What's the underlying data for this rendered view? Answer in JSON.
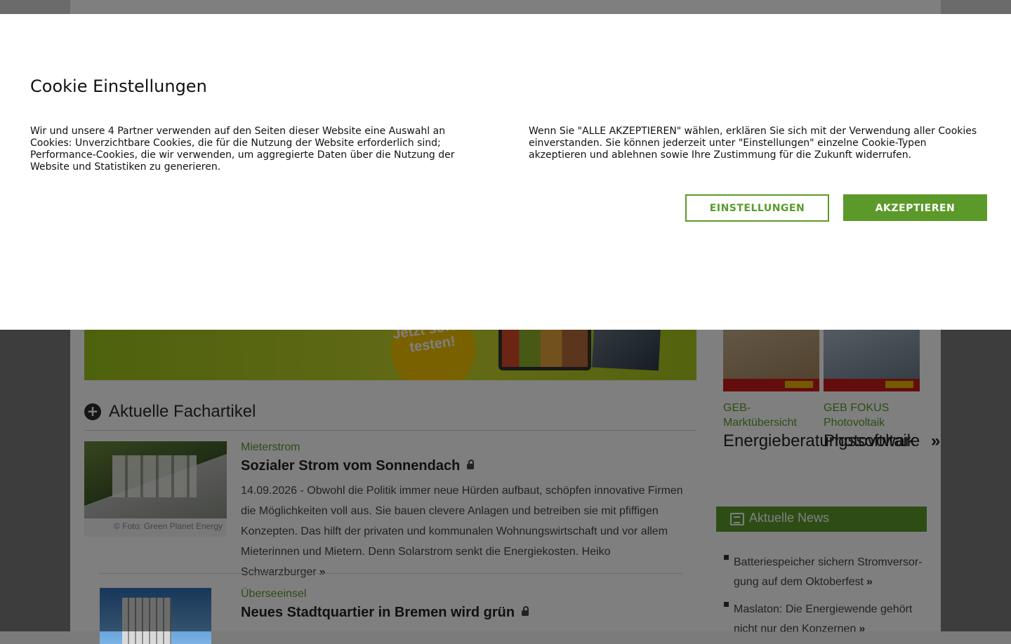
{
  "cookie_modal": {
    "title": "Cookie Einstellungen",
    "text_left": "Wir und unsere 4 Partner verwenden auf den Seiten dieser Website eine Auswahl an Cookies: Unverzichtbare Cookies, die für die Nutzung der Website erforderlich sind; Performance-Cookies, die wir verwenden, um aggregierte Daten über die Nutzung der Website und Statistiken zu generieren.",
    "text_right": "Wenn Sie \"ALLE AKZEPTIEREN\" wählen, erklären Sie sich mit der Verwendung aller Cookies einverstanden. Sie können jederzeit unter \"Einstellungen\" einzelne Cookie-Typen akzeptieren und ablehnen sowie Ihre Zustimmung für die Zukunft widerrufen.",
    "settings_button": "EINSTELLUNGEN",
    "accept_button": "AKZEPTIEREN"
  },
  "banner": {
    "badge": "Jetzt sofort testen!"
  },
  "section": {
    "title": "Aktuelle Fachartikel"
  },
  "articles": [
    {
      "kicker": "Mieterstrom",
      "headline": "Sozialer Strom vom Sonnendach",
      "image_caption": "© Foto: Green Planet Energy",
      "teaser": "14.09.2026 - Obwohl die Politik immer neue Hürden aufbaut, schöpfen innovative Firmen die Möglichkeiten voll aus. Sie bauen clevere Anlagen und betreiben sie mit pfiffigen Konzepten. Das hilft der privaten und kommunalen Wohnungswirtschaft und vor allem Mieterinnen und Mietern. Denn Solarstrom senkt die Energiekosten. Heiko Schwarzburger"
    },
    {
      "kicker": "Überseeinsel",
      "headline": "Neues Stadtquartier in Bremen wird grün"
    }
  ],
  "sidebar": {
    "cards": [
      {
        "kicker": "GEB-Marktübersicht",
        "title": "Energieberatungssoftware"
      },
      {
        "kicker": "GEB FOKUS Photovoltaik",
        "title": "Photovoltaik"
      }
    ],
    "news_title": "Aktuelle News",
    "news_items": [
      "Batteriespeicher sichern Stromversor-gung auf dem Oktoberfest",
      "Maslaton: Die Energiewende gehört nicht nur den Konzernen"
    ]
  }
}
